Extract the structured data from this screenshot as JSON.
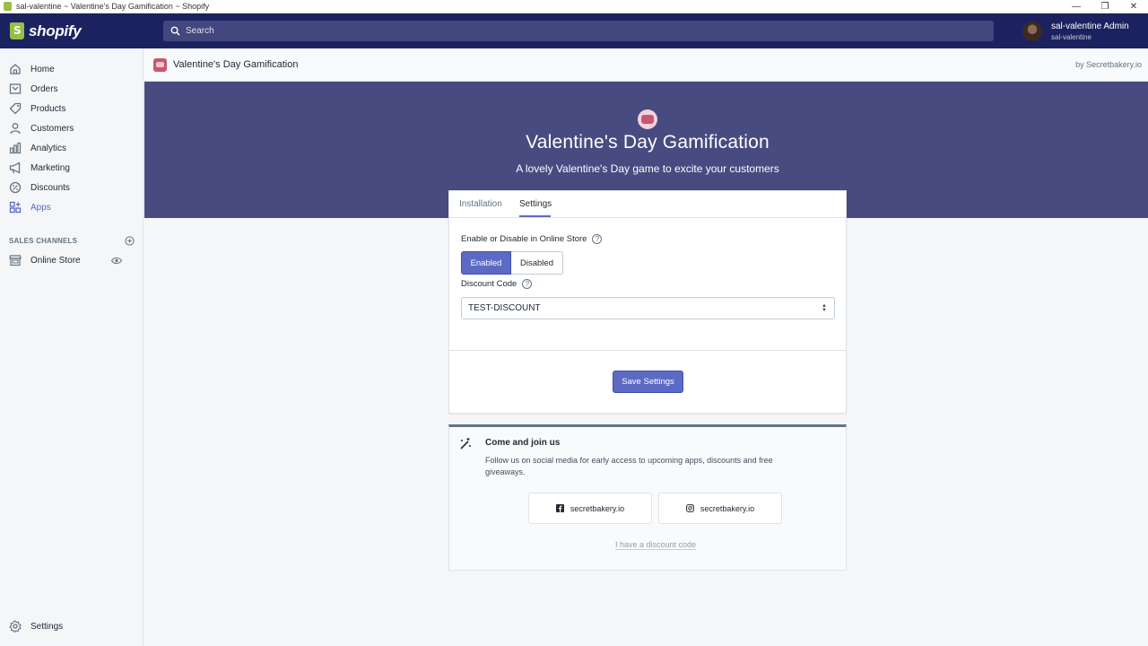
{
  "window": {
    "title": "sal-valentine ~ Valentine's Day Gamification ~ Shopify"
  },
  "topbar": {
    "logo_text": "shopify",
    "search_placeholder": "Search",
    "account_name": "sal-valentine Admin",
    "account_store": "sal-valentine"
  },
  "sidebar": {
    "items": [
      {
        "label": "Home",
        "icon": "home-icon"
      },
      {
        "label": "Orders",
        "icon": "orders-icon"
      },
      {
        "label": "Products",
        "icon": "tag-icon"
      },
      {
        "label": "Customers",
        "icon": "person-icon"
      },
      {
        "label": "Analytics",
        "icon": "bar-chart-icon"
      },
      {
        "label": "Marketing",
        "icon": "megaphone-icon"
      },
      {
        "label": "Discounts",
        "icon": "discount-icon"
      },
      {
        "label": "Apps",
        "icon": "apps-icon",
        "active": true
      }
    ],
    "sales_channels_header": "SALES CHANNELS",
    "channels": [
      {
        "label": "Online Store",
        "icon": "store-icon"
      }
    ],
    "settings_label": "Settings"
  },
  "app_header": {
    "title": "Valentine's Day Gamification",
    "by": "by Secretbakery.io"
  },
  "hero": {
    "title": "Valentine's Day Gamification",
    "subtitle": "A lovely Valentine's Day game to excite your customers"
  },
  "settings_card": {
    "tabs": [
      {
        "label": "Installation",
        "active": false
      },
      {
        "label": "Settings",
        "active": true
      }
    ],
    "enable_label": "Enable or Disable in Online Store",
    "segmented": {
      "enabled": "Enabled",
      "disabled": "Disabled",
      "selected": "Enabled"
    },
    "discount_label": "Discount Code",
    "discount_value": "TEST-DISCOUNT",
    "save_label": "Save Settings"
  },
  "join_card": {
    "title": "Come and join us",
    "description": "Follow us on social media for early access to upcoming apps, discounts and free giveaways.",
    "facebook_label": "secretbakery.io",
    "instagram_label": "secretbakery.io",
    "discount_link": "I have a discount code"
  },
  "colors": {
    "topbar": "#1c2260",
    "hero": "#474b80",
    "accent": "#5c6ac4"
  }
}
